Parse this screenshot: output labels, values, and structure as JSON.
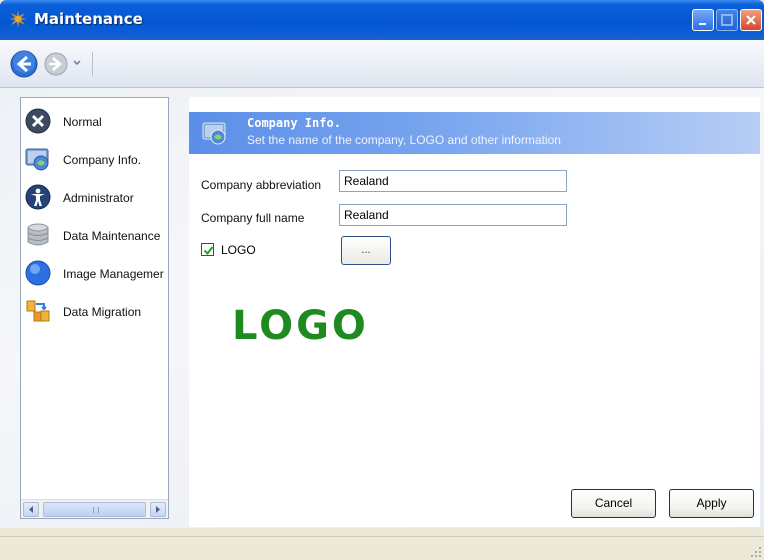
{
  "window": {
    "title": "Maintenance"
  },
  "sidebar": {
    "items": [
      {
        "label": "Normal",
        "icon": "normal-icon"
      },
      {
        "label": "Company Info.",
        "icon": "company-info-icon"
      },
      {
        "label": "Administrator",
        "icon": "administrator-icon"
      },
      {
        "label": "Data Maintenance",
        "icon": "database-icon"
      },
      {
        "label": "Image Managemer",
        "icon": "image-management-icon"
      },
      {
        "label": "Data Migration",
        "icon": "data-migration-icon"
      }
    ]
  },
  "panel": {
    "title": "Company Info.",
    "subtitle": "Set the name of the company, LOGO and other information",
    "abbr_label": "Company abbreviation",
    "abbr_value": "Realand",
    "full_label": "Company full name",
    "full_value": "Realand",
    "logo_checkbox_label": "LOGO",
    "logo_checked": true,
    "browse_label": "...",
    "logo_preview_text": "LOGO"
  },
  "buttons": {
    "cancel": "Cancel",
    "apply": "Apply"
  },
  "colors": {
    "titlebar": "#0556d2",
    "banner": "#5b8fe8",
    "logo": "#1f8a1f"
  }
}
